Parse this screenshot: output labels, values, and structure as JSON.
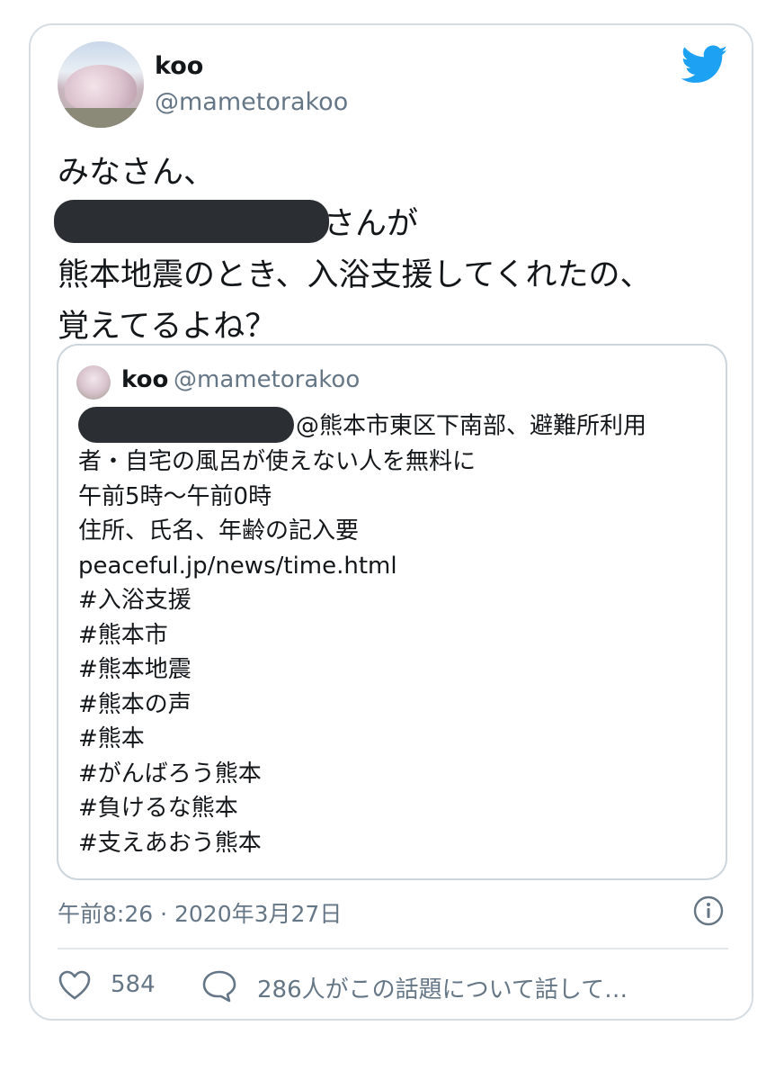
{
  "author": {
    "name": "koo",
    "handle": "@mametorakoo"
  },
  "tweet": {
    "line1": "みなさん、",
    "line2_suffix": "さんが",
    "line3": "熊本地震のとき、入浴支援してくれたの、",
    "line4": "覚えてるよね？"
  },
  "quoted_tweet": {
    "name": "koo",
    "handle": "@mametorakoo",
    "lines": [
      "@熊本市東区下南部、避難所利用",
      "者・自宅の風呂が使えない人を無料に",
      "午前5時〜午前0時",
      "住所、氏名、年齢の記入要",
      "peaceful.jp/news/time.html",
      "#入浴支援",
      "#熊本市",
      "#熊本地震",
      "#熊本の声",
      "#熊本",
      "#がんばろう熊本",
      "#負けるな熊本",
      "#支えあおう熊本"
    ]
  },
  "timestamp": "午前8:26 · 2020年3月27日",
  "likes_count": "584",
  "conversation_text": "286人がこの話題について話して…",
  "icons": {
    "brand": "twitter-bird-icon",
    "info": "info-icon",
    "like": "heart-icon",
    "reply": "speech-bubble-icon"
  },
  "colors": {
    "brand": "#1DA1F2",
    "text": "#14171A",
    "secondary": "#657786",
    "border": "#CCD6DD"
  }
}
